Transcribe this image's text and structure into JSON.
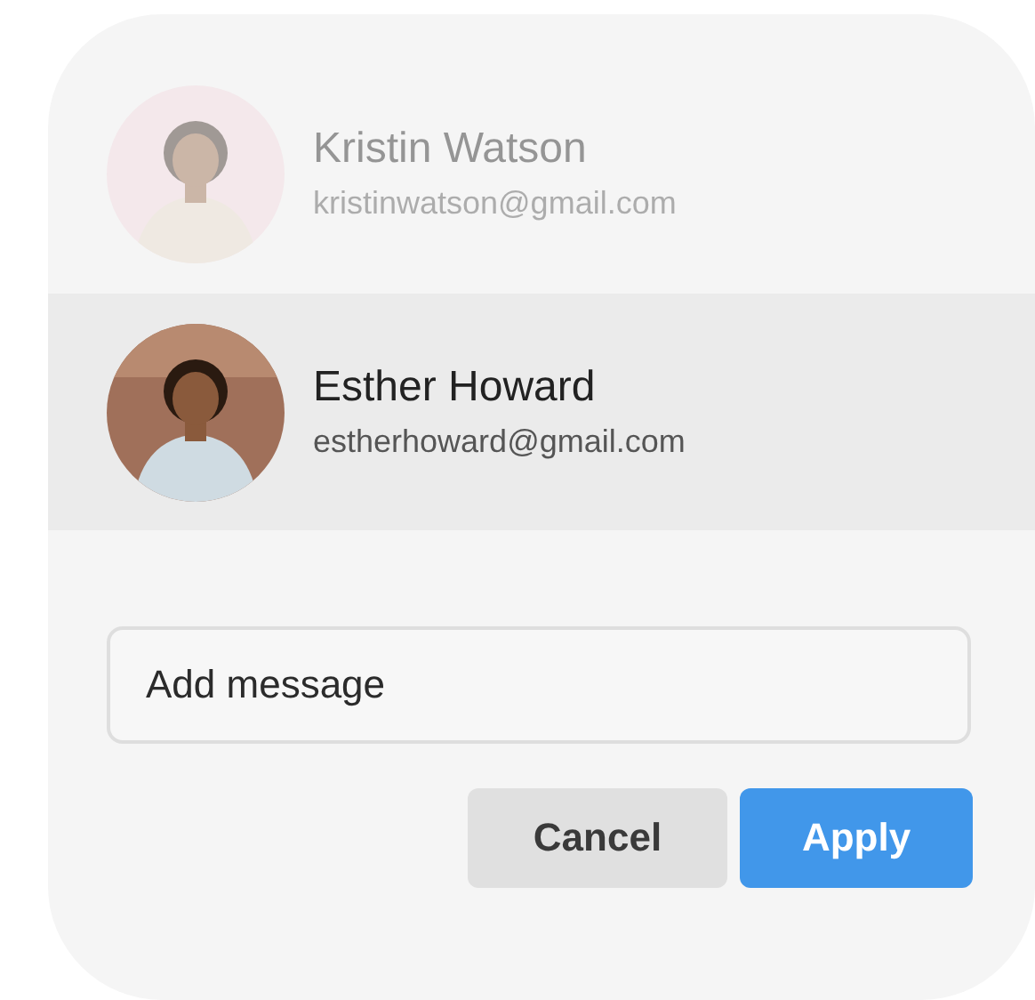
{
  "contacts": [
    {
      "name": "Kristin Watson",
      "email": "kristinwatson@gmail.com",
      "selected": false,
      "disabled": true
    },
    {
      "name": "Esther Howard",
      "email": "estherhoward@gmail.com",
      "selected": true,
      "disabled": false
    }
  ],
  "message": {
    "placeholder": "Add message"
  },
  "buttons": [
    {
      "label": "Cancel",
      "kind": "secondary"
    },
    {
      "label": "Apply",
      "kind": "primary"
    }
  ]
}
